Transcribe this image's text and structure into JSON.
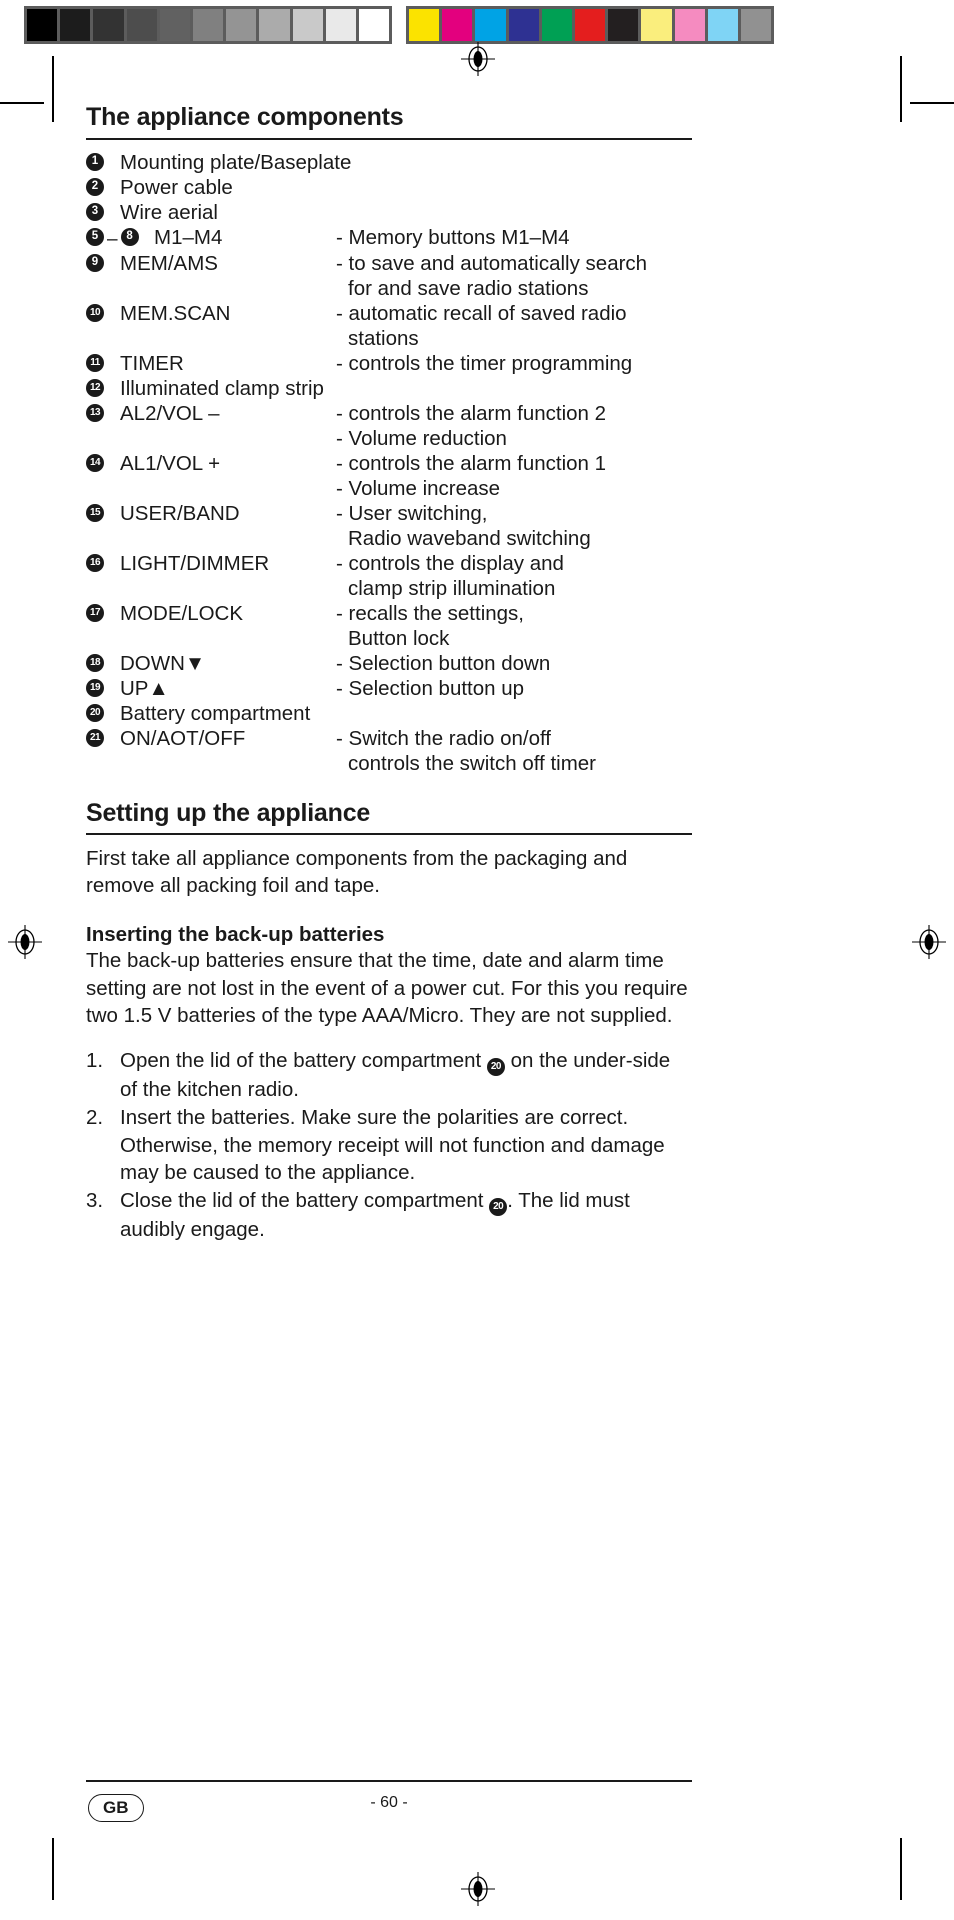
{
  "calibration": {
    "grayscale": [
      "#000000",
      "#1c1c1c",
      "#333333",
      "#4d4d4d",
      "#616161",
      "#808080",
      "#949494",
      "#ababab",
      "#c9c9c9",
      "#e9e9e9",
      "#ffffff"
    ],
    "colors": [
      "#fbe300",
      "#e3007e",
      "#00a3e5",
      "#2e3192",
      "#00a054",
      "#e41e1e",
      "#231f20",
      "#faee7d",
      "#f58bc0",
      "#7fd4f5",
      "#919191"
    ]
  },
  "section1": {
    "title": "The appliance components",
    "items": [
      {
        "num": "1",
        "label": "Mounting plate/Baseplate",
        "desc": []
      },
      {
        "num": "2",
        "label": "Power cable",
        "desc": []
      },
      {
        "num": "3",
        "label": "Wire aerial",
        "desc": []
      },
      {
        "num": "5",
        "num2": "8",
        "label": "M1–M4",
        "desc": [
          "- Memory buttons M1–M4"
        ]
      },
      {
        "num": "9",
        "label": "MEM/AMS",
        "desc": [
          "- to save and automatically search",
          "for and save radio stations"
        ]
      },
      {
        "num": "10",
        "label": "MEM.SCAN",
        "desc": [
          "- automatic recall of saved radio",
          "stations"
        ]
      },
      {
        "num": "11",
        "label": "TIMER",
        "desc": [
          "- controls the timer programming"
        ]
      },
      {
        "num": "12",
        "label": "Illuminated clamp strip",
        "desc": []
      },
      {
        "num": "13",
        "label": "AL2/VOL –",
        "desc": [
          "- controls the alarm function 2",
          "- Volume reduction"
        ]
      },
      {
        "num": "14",
        "label": "AL1/VOL +",
        "desc": [
          "- controls the alarm function 1",
          "- Volume increase"
        ]
      },
      {
        "num": "15",
        "label": "USER/BAND",
        "desc": [
          "- User switching,",
          "Radio waveband switching"
        ]
      },
      {
        "num": "16",
        "label": "LIGHT/DIMMER",
        "desc": [
          "- controls the display and",
          "clamp strip illumination"
        ]
      },
      {
        "num": "17",
        "label": "MODE/LOCK",
        "desc": [
          "- recalls the settings,",
          "Button lock"
        ]
      },
      {
        "num": "18",
        "label": "DOWN▼",
        "desc": [
          "- Selection button down"
        ]
      },
      {
        "num": "19",
        "label": "UP▲",
        "desc": [
          "- Selection button up"
        ]
      },
      {
        "num": "20",
        "label": "Battery compartment",
        "desc": []
      },
      {
        "num": "21",
        "label": "ON/AOT/OFF",
        "desc": [
          "- Switch the radio on/off",
          "controls the switch off timer"
        ]
      }
    ]
  },
  "section2": {
    "title": "Setting up the appliance",
    "intro": "First take all appliance components from the packaging and remove all packing foil and tape.",
    "subheading": "Inserting the back-up batteries",
    "paragraph": "The back-up batteries ensure that the time, date and alarm time setting are not lost in the event of a power cut. For this you require two 1.5 V batteries of the type  AAA/Micro. They are not supplied.",
    "steps": [
      {
        "num": "1.",
        "pre": "Open the lid of the battery compartment ",
        "badge": "20",
        "post": " on the under-side of the kitchen radio."
      },
      {
        "num": "2.",
        "pre": "Insert the batteries. Make sure the polarities are correct. Otherwise, the memory receipt will not function and damage may be caused to the appliance.",
        "badge": "",
        "post": ""
      },
      {
        "num": "3.",
        "pre": "Close the lid of the battery compartment ",
        "badge": "20",
        "post": ". The lid must audibly engage."
      }
    ]
  },
  "footer": {
    "language": "GB",
    "page_number": "- 60 -"
  }
}
